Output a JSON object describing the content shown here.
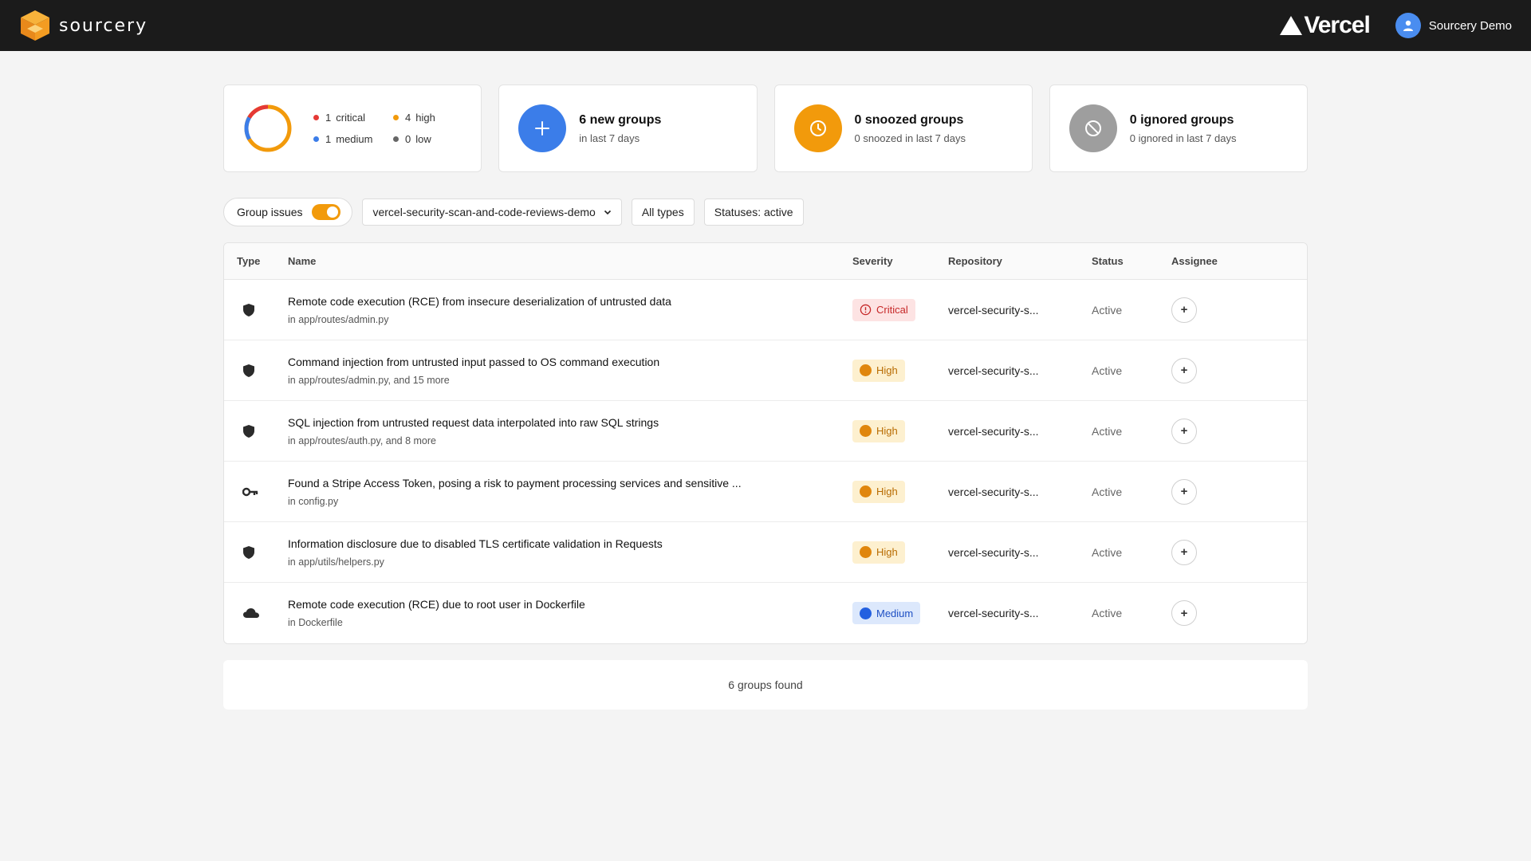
{
  "header": {
    "brand": "sourcery",
    "partner_logo": "Vercel",
    "user_name": "Sourcery Demo"
  },
  "severity_summary": {
    "items": [
      {
        "count": "1",
        "label": "critical",
        "color": "#e53935"
      },
      {
        "count": "4",
        "label": "high",
        "color": "#f29a0b"
      },
      {
        "count": "1",
        "label": "medium",
        "color": "#3b7de9"
      },
      {
        "count": "0",
        "label": "low",
        "color": "#666666"
      }
    ]
  },
  "cards": [
    {
      "title": "6 new groups",
      "sub": "in last 7 days",
      "icon": "plus-icon",
      "color": "#3b7de9"
    },
    {
      "title": "0 snoozed groups",
      "sub": "0 snoozed in last 7 days",
      "icon": "clock-icon",
      "color": "#f29a0b"
    },
    {
      "title": "0 ignored groups",
      "sub": "0 ignored in last 7 days",
      "icon": "ban-icon",
      "color": "#9e9e9e"
    }
  ],
  "filters": {
    "group_label": "Group issues",
    "group_enabled": true,
    "repo": "vercel-security-scan-and-code-reviews-demo",
    "types": "All types",
    "statuses": "Statuses: active"
  },
  "table": {
    "columns": [
      "Type",
      "Name",
      "Severity",
      "Repository",
      "Status",
      "Assignee"
    ],
    "rows": [
      {
        "type_icon": "shield-icon",
        "title": "Remote code execution (RCE) from insecure deserialization of untrusted data",
        "path": "in app/routes/admin.py",
        "severity": "Critical",
        "repo": "vercel-security-s...",
        "status": "Active"
      },
      {
        "type_icon": "shield-icon",
        "title": "Command injection from untrusted input passed to OS command execution",
        "path": "in app/routes/admin.py, and 15 more",
        "severity": "High",
        "repo": "vercel-security-s...",
        "status": "Active"
      },
      {
        "type_icon": "shield-icon",
        "title": "SQL injection from untrusted request data interpolated into raw SQL strings",
        "path": "in app/routes/auth.py, and 8 more",
        "severity": "High",
        "repo": "vercel-security-s...",
        "status": "Active"
      },
      {
        "type_icon": "key-icon",
        "title": "Found a Stripe Access Token, posing a risk to payment processing services and sensitive ...",
        "path": "in config.py",
        "severity": "High",
        "repo": "vercel-security-s...",
        "status": "Active"
      },
      {
        "type_icon": "shield-icon",
        "title": "Information disclosure due to disabled TLS certificate validation in Requests",
        "path": "in app/utils/helpers.py",
        "severity": "High",
        "repo": "vercel-security-s...",
        "status": "Active"
      },
      {
        "type_icon": "cloud-icon",
        "title": "Remote code execution (RCE) due to root user in Dockerfile",
        "path": "in Dockerfile",
        "severity": "Medium",
        "repo": "vercel-security-s...",
        "status": "Active"
      }
    ]
  },
  "footer": {
    "summary": "6 groups found"
  },
  "assign_label": "+"
}
